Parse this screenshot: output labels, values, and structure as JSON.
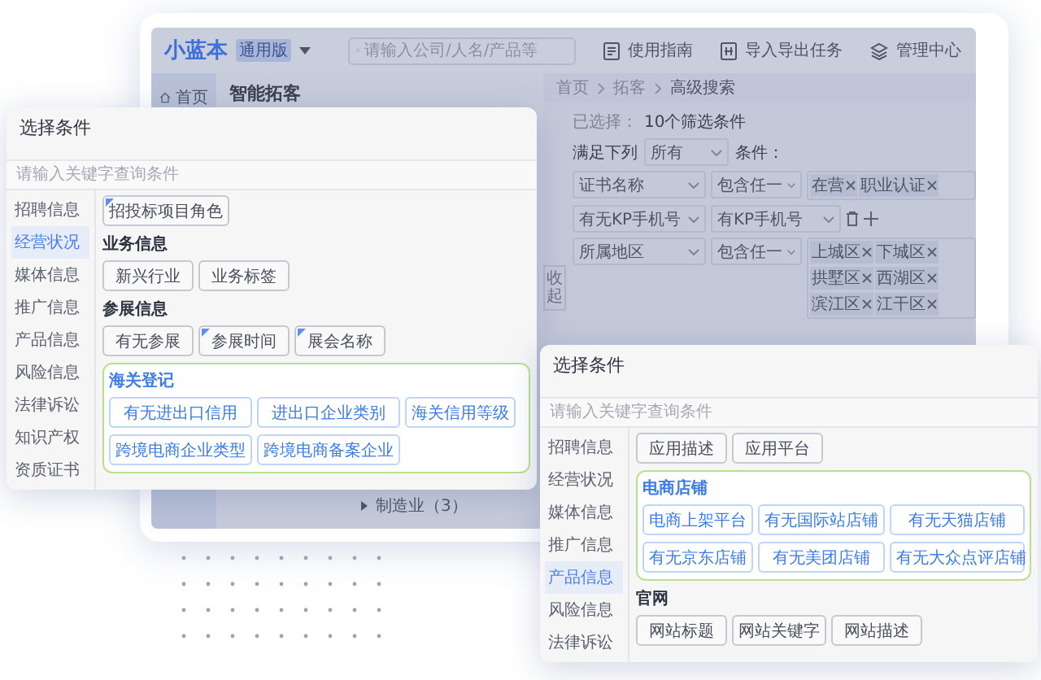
{
  "app": {
    "logo": "小蓝本",
    "edition": "通用版",
    "search_placeholder": "请输入公司/人名/产品等",
    "header_links": [
      "使用指南",
      "导入导出任务",
      "管理中心"
    ],
    "nav_home": "首页",
    "page_title": "智能拓客",
    "breadcrumb": [
      "首页",
      "拓客",
      "高级搜索"
    ],
    "selected_label": "已选择：",
    "selected_value": "10个筛选条件",
    "match_prefix": "满足下列",
    "match_mode": "所有",
    "match_suffix": "条件：",
    "collapse": "收起",
    "filters": [
      {
        "kind": "tags",
        "field": "证书名称",
        "operator": "包含任一",
        "tags": [
          "在营",
          "职业认证"
        ]
      },
      {
        "kind": "choice",
        "field": "有无KP手机号",
        "operator": "有KP手机号"
      },
      {
        "kind": "tags",
        "field": "所属地区",
        "operator": "包含任一",
        "tags": [
          "上城区",
          "下城区",
          "拱墅区",
          "西湖区",
          "滨江区",
          "江干区"
        ]
      }
    ],
    "tree": [
      {
        "label": "制造业（3）",
        "expanded": false
      }
    ]
  },
  "panels": [
    {
      "title": "选择条件",
      "placeholder": "请输入关键字查询条件",
      "categories": [
        {
          "label": "招聘信息",
          "selected": false
        },
        {
          "label": "经营状况",
          "selected": true
        },
        {
          "label": "媒体信息",
          "selected": false
        },
        {
          "label": "推广信息",
          "selected": false
        },
        {
          "label": "产品信息",
          "selected": false
        },
        {
          "label": "风险信息",
          "selected": false
        },
        {
          "label": "法律诉讼",
          "selected": false
        },
        {
          "label": "知识产权",
          "selected": false
        },
        {
          "label": "资质证书",
          "selected": false
        }
      ],
      "sections": [
        {
          "highlighted": false,
          "options": [
            {
              "label": "招投标项目角色",
              "marked": true
            }
          ]
        },
        {
          "title": "业务信息",
          "highlighted": false,
          "options": [
            {
              "label": "新兴行业",
              "marked": false
            },
            {
              "label": "业务标签",
              "marked": false
            }
          ]
        },
        {
          "title": "参展信息",
          "highlighted": false,
          "options": [
            {
              "label": "有无参展",
              "marked": false
            },
            {
              "label": "参展时间",
              "marked": true
            },
            {
              "label": "展会名称",
              "marked": true
            }
          ]
        },
        {
          "title": "海关登记",
          "highlighted": true,
          "options": [
            {
              "label": "有无进出口信用",
              "marked": false
            },
            {
              "label": "进出口企业类别",
              "marked": false
            },
            {
              "label": "海关信用等级",
              "marked": false
            },
            {
              "label": "跨境电商企业类型",
              "marked": false
            },
            {
              "label": "跨境电商备案企业",
              "marked": false
            }
          ]
        }
      ]
    },
    {
      "title": "选择条件",
      "placeholder": "请输入关键字查询条件",
      "categories": [
        {
          "label": "招聘信息",
          "selected": false
        },
        {
          "label": "经营状况",
          "selected": false
        },
        {
          "label": "媒体信息",
          "selected": false
        },
        {
          "label": "推广信息",
          "selected": false
        },
        {
          "label": "产品信息",
          "selected": true
        },
        {
          "label": "风险信息",
          "selected": false
        },
        {
          "label": "法律诉讼",
          "selected": false
        }
      ],
      "sections": [
        {
          "highlighted": false,
          "options": [
            {
              "label": "应用描述",
              "marked": false
            },
            {
              "label": "应用平台",
              "marked": false
            }
          ]
        },
        {
          "title": "电商店铺",
          "highlighted": true,
          "options": [
            {
              "label": "电商上架平台",
              "marked": false
            },
            {
              "label": "有无国际站店铺",
              "marked": false
            },
            {
              "label": "有无天猫店铺",
              "marked": false
            },
            {
              "label": "有无京东店铺",
              "marked": false
            },
            {
              "label": "有无美团店铺",
              "marked": false
            },
            {
              "label": "有无大众点评店铺",
              "marked": false
            }
          ]
        },
        {
          "title": "官网",
          "highlighted": false,
          "options": [
            {
              "label": "网站标题",
              "marked": false
            },
            {
              "label": "网站关键字",
              "marked": false
            },
            {
              "label": "网站描述",
              "marked": false
            }
          ]
        }
      ]
    }
  ]
}
